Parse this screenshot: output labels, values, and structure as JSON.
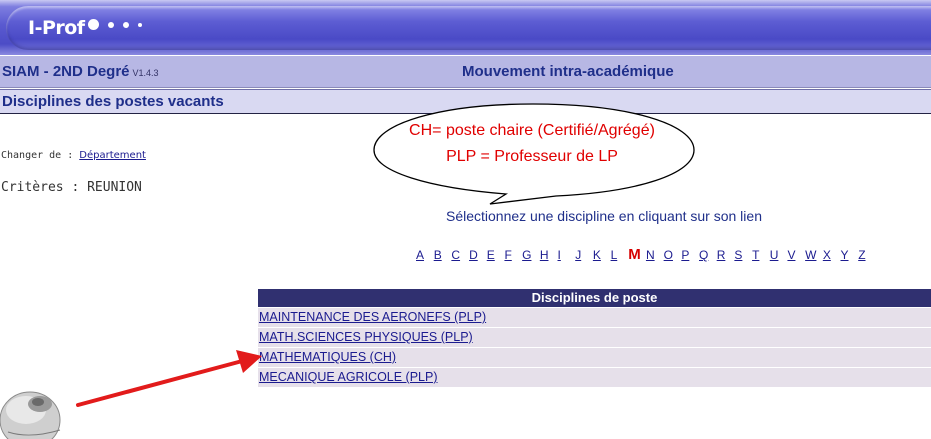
{
  "header": {
    "brand": "I-Prof"
  },
  "titlebar": {
    "app_name": "SIAM - 2ND Degré",
    "version": "V1.4.3",
    "module": "Mouvement intra-académique"
  },
  "page": {
    "title": "Disciplines des postes vacants"
  },
  "filters": {
    "change_label": "Changer de :",
    "change_link": "Département",
    "criteria": "Critères : REUNION"
  },
  "callout": {
    "line1": "CH= poste chaire (Certifié/Agrégé)",
    "line2": "PLP = Professeur de LP",
    "text_color": "#e00000"
  },
  "instruction": "Sélectionnez une discipline en cliquant sur son lien",
  "alphabet": {
    "letters": [
      "A",
      "B",
      "C",
      "D",
      "E",
      "F",
      "G",
      "H",
      "I",
      "J",
      "K",
      "L",
      "M",
      "N",
      "O",
      "P",
      "Q",
      "R",
      "S",
      "T",
      "U",
      "V",
      "W",
      "X",
      "Y",
      "Z"
    ],
    "selected": "M"
  },
  "table": {
    "header": "Disciplines de poste",
    "rows": [
      "MAINTENANCE DES AERONEFS (PLP)",
      "MATH.SCIENCES PHYSIQUES (PLP)",
      "MATHEMATIQUES (CH)",
      "MECANIQUE AGRICOLE (PLP)"
    ]
  },
  "colors": {
    "header_bar": "#b7b7e4",
    "table_header": "#303070",
    "table_row": "#e6e0ea",
    "link": "#1b1b8f",
    "selected_letter": "#d60000",
    "arrow": "#e21b1b"
  }
}
